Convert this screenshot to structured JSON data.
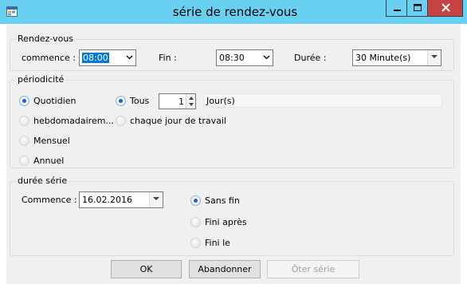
{
  "window": {
    "title": "série de rendez-vous"
  },
  "rendezvous": {
    "legend": "Rendez-vous",
    "start_label": "commence :",
    "start_value": "08:00",
    "end_label": "Fin :",
    "end_value": "08:30",
    "duration_label": "Durée :",
    "duration_value": "30 Minute(s)"
  },
  "periodicite": {
    "legend": "périodicité",
    "options": {
      "quotidien": "Quotidien",
      "hebdomadaire": "hebdomadairem...",
      "mensuel": "Mensuel",
      "annuel": "Annuel"
    },
    "selected": "quotidien",
    "tous_label": "Tous",
    "tous_value": "1",
    "unit_label": "Jour(s)",
    "chaque_jour_label": "chaque jour de travail"
  },
  "duree_serie": {
    "legend": "durée série",
    "start_label": "Commence :",
    "start_value": "16.02.2016",
    "options": {
      "sans_fin": "Sans fin",
      "fini_apres": "Fini après",
      "fini_le": "Fini le"
    },
    "selected": "sans_fin"
  },
  "buttons": {
    "ok": "OK",
    "abandonner": "Abandonner",
    "oter_serie": "Ôter série"
  }
}
